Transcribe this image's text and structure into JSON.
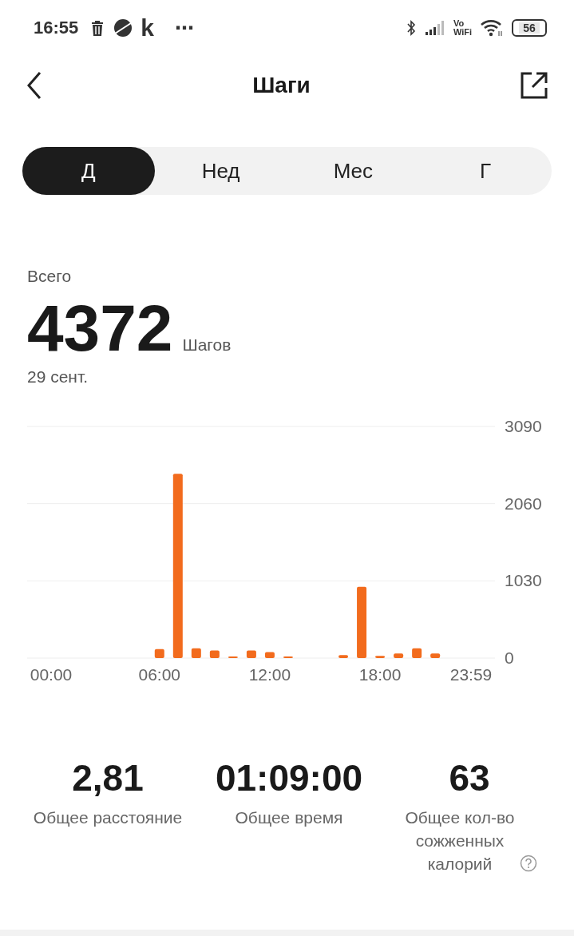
{
  "status_bar": {
    "time": "16:55",
    "app_letter": "k",
    "more": "⋯",
    "vowifi": [
      "Vo",
      "WiFi"
    ],
    "battery": "56"
  },
  "header": {
    "title": "Шаги"
  },
  "tabs": [
    {
      "label": "Д",
      "selected": true
    },
    {
      "label": "Нед",
      "selected": false
    },
    {
      "label": "Мес",
      "selected": false
    },
    {
      "label": "Г",
      "selected": false
    }
  ],
  "summary": {
    "label": "Всего",
    "value": "4372",
    "unit": "Шагов",
    "date": "29 сент."
  },
  "chart": {
    "chart_data": {
      "type": "bar",
      "x": [
        0,
        1,
        2,
        3,
        4,
        5,
        6,
        7,
        8,
        9,
        10,
        11,
        12,
        13,
        14,
        15,
        16,
        17,
        18,
        19,
        20,
        21,
        22,
        23
      ],
      "series": [
        {
          "color": "#f26b1d",
          "values": [
            0,
            0,
            0,
            0,
            0,
            0,
            120,
            2460,
            130,
            100,
            20,
            100,
            80,
            20,
            0,
            0,
            40,
            950,
            30,
            60,
            130,
            60,
            0,
            0
          ]
        }
      ],
      "xlim": [
        -1.2,
        24.25
      ],
      "ylim": [
        0,
        3090
      ],
      "xticks": [
        {
          "value": 0,
          "label": "00:00"
        },
        {
          "value": 6,
          "label": "06:00"
        },
        {
          "value": 12,
          "label": "12:00"
        },
        {
          "value": 18,
          "label": "18:00"
        },
        {
          "value": 23.98,
          "label": "23:59"
        }
      ],
      "yticks": [
        0,
        1030,
        2060,
        3090
      ]
    }
  },
  "stats": [
    {
      "value": "2,81",
      "label": "Общее расстояние",
      "help": false
    },
    {
      "value": "01:09:00",
      "label": "Общее время",
      "help": false
    },
    {
      "value": "63",
      "label": "Общее кол-во сожженных калорий",
      "help": true
    }
  ]
}
